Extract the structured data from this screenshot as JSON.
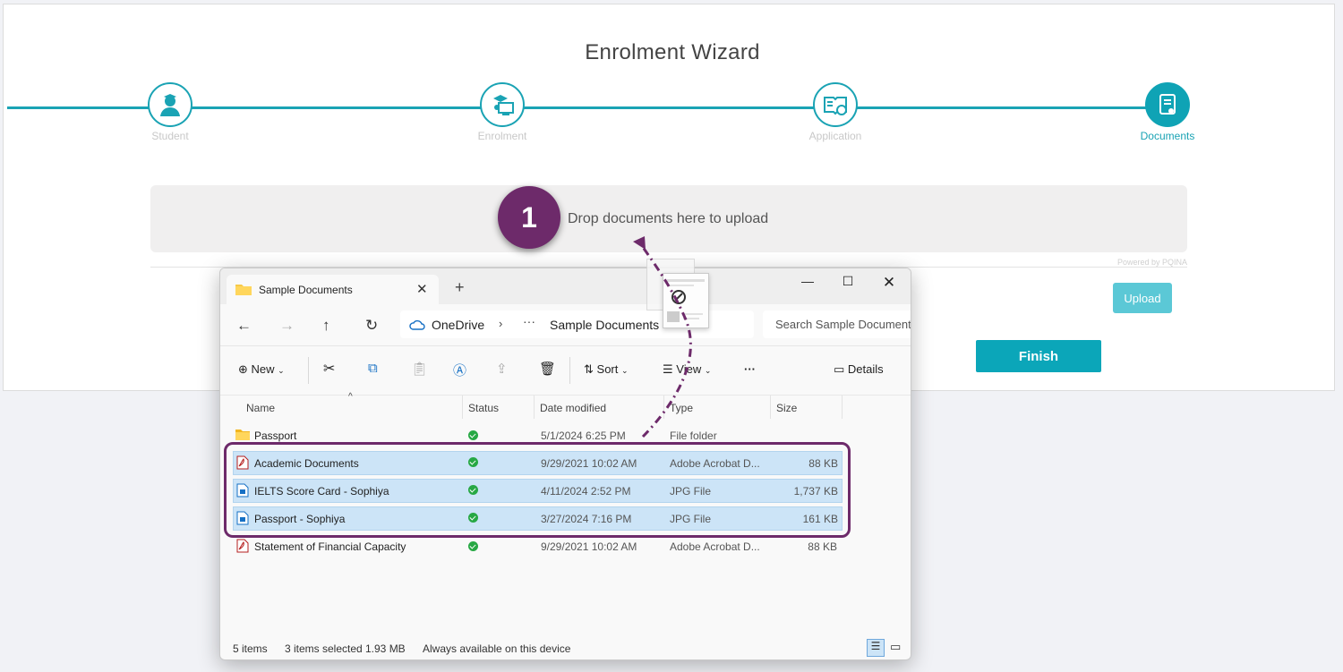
{
  "wizard": {
    "title": "Enrolment Wizard",
    "steps": [
      {
        "label": "Student",
        "icon": "student-icon",
        "active": false
      },
      {
        "label": "Enrolment",
        "icon": "enrolment-icon",
        "active": false
      },
      {
        "label": "Application",
        "icon": "application-icon",
        "active": false
      },
      {
        "label": "Documents",
        "icon": "documents-icon",
        "active": true
      }
    ],
    "accent": "#1aa3b4"
  },
  "dropzone": {
    "text": "Drop documents here to upload",
    "powered": "Powered by PQINA"
  },
  "buttons": {
    "upload": "Upload",
    "finish": "Finish"
  },
  "callout": {
    "number": "1",
    "color": "#6d2a6a"
  },
  "explorer": {
    "tab_title": "Sample Documents",
    "address": {
      "root": "OneDrive",
      "ellipsis": "···",
      "current": "Sample Documents"
    },
    "search_placeholder": "Search Sample Documents",
    "toolbar": {
      "new": "New",
      "sort": "Sort",
      "view": "View",
      "more": "···",
      "details": "Details"
    },
    "columns": {
      "name": "Name",
      "status": "Status",
      "date": "Date modified",
      "type": "Type",
      "size": "Size"
    },
    "files": [
      {
        "name": "Passport",
        "date": "5/1/2024 6:25 PM",
        "type": "File folder",
        "size": "",
        "selected": false,
        "kind": "folder"
      },
      {
        "name": "Academic Documents",
        "date": "9/29/2021 10:02 AM",
        "type": "Adobe Acrobat D...",
        "size": "88 KB",
        "selected": true,
        "kind": "pdf"
      },
      {
        "name": "IELTS Score Card - Sophiya",
        "date": "4/11/2024 2:52 PM",
        "type": "JPG File",
        "size": "1,737 KB",
        "selected": true,
        "kind": "jpg"
      },
      {
        "name": "Passport - Sophiya",
        "date": "3/27/2024 7:16 PM",
        "type": "JPG File",
        "size": "161 KB",
        "selected": true,
        "kind": "jpg"
      },
      {
        "name": "Statement of Financial Capacity",
        "date": "9/29/2021 10:02 AM",
        "type": "Adobe Acrobat D...",
        "size": "88 KB",
        "selected": false,
        "kind": "pdf"
      }
    ],
    "status": {
      "items": "5 items",
      "selected": "3 items selected",
      "size": "1.93 MB",
      "availability": "Always available on this device"
    }
  }
}
